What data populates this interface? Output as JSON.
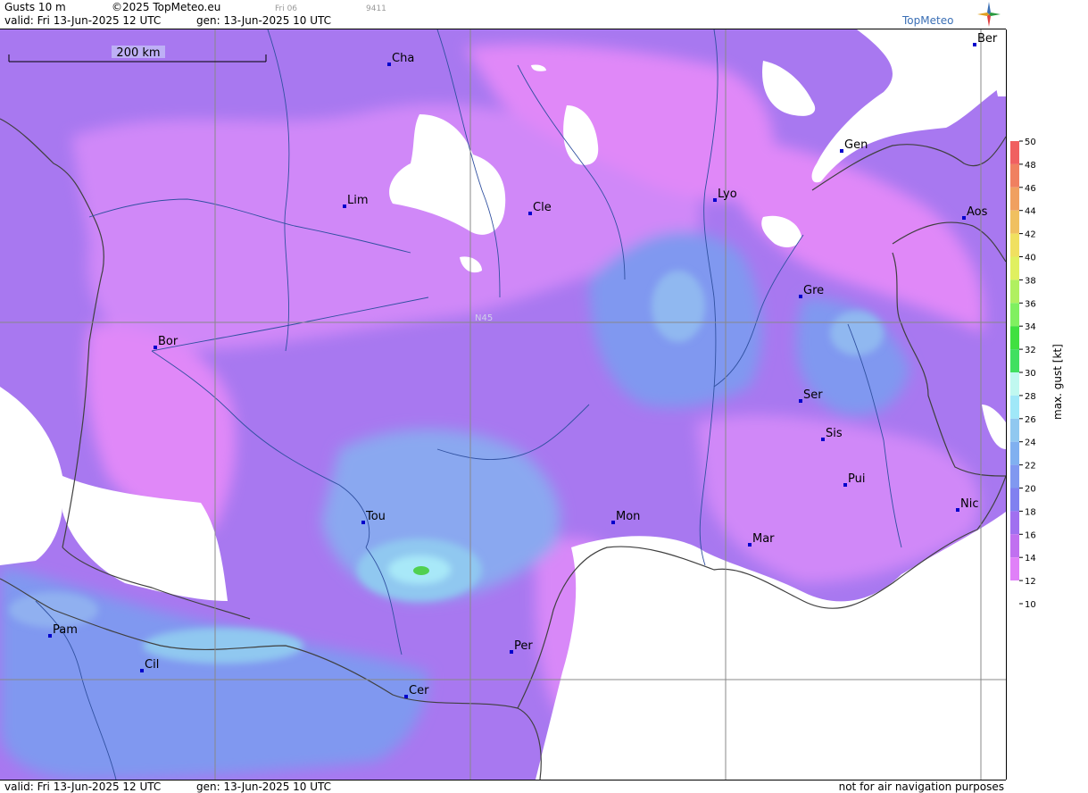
{
  "header": {
    "product": "Gusts 10 m",
    "copyright": "©2025 TopMeteo.eu",
    "valid": "valid:  Fri  13-Jun-2025  12 UTC",
    "gen": "gen: 13-Jun-2025 10 UTC",
    "small_code1": "Fri 06",
    "small_code2": "9411",
    "logo": "TopMeteo"
  },
  "footer": {
    "valid": "valid:  Fri  13-Jun-2025  12 UTC",
    "gen": "gen: 13-Jun-2025 10 UTC",
    "disclaimer": "not for air navigation purposes"
  },
  "map": {
    "scale_label": "200 km",
    "lat_label": "N45",
    "cities": [
      "Ber",
      "Cha",
      "Gen",
      "Lim",
      "Cle",
      "Lyo",
      "Aos",
      "Gre",
      "Bor",
      "Ser",
      "Sis",
      "Pui",
      "Tou",
      "Mon",
      "Mar",
      "Nic",
      "Pam",
      "Per",
      "Cil",
      "Cer"
    ]
  },
  "legend": {
    "title": "max. gust  [kt]",
    "ticks": [
      "50",
      "48",
      "46",
      "44",
      "42",
      "40",
      "38",
      "36",
      "34",
      "32",
      "30",
      "28",
      "26",
      "24",
      "22",
      "20",
      "18",
      "16",
      "14",
      "12",
      "10"
    ],
    "colors": [
      "#f06060",
      "#f08060",
      "#f0a060",
      "#f0c060",
      "#f0e060",
      "#e0f060",
      "#b0f060",
      "#80f060",
      "#40e040",
      "#40e060",
      "#c0f8f0",
      "#a0e8f8",
      "#90c8f0",
      "#80b0f0",
      "#8098f0",
      "#8080f0",
      "#a070f0",
      "#c070f0",
      "#e080f8",
      "#ffffff"
    ]
  }
}
